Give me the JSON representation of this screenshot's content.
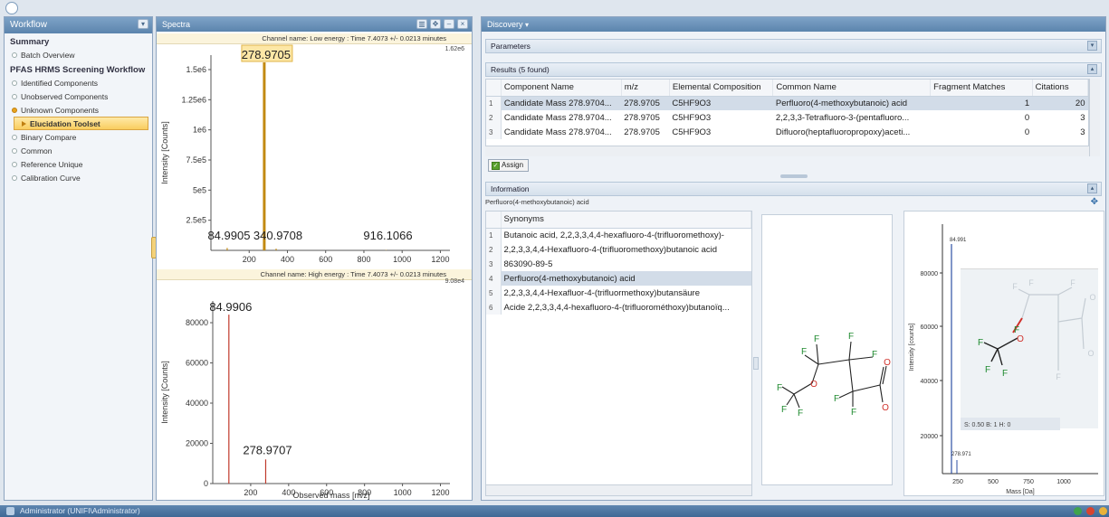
{
  "workflow": {
    "title": "Workflow",
    "sections": [
      {
        "title": "Summary",
        "items": [
          {
            "label": "Batch Overview",
            "state": "off"
          }
        ]
      },
      {
        "title": "PFAS HRMS Screening Workflow",
        "items": [
          {
            "label": "Identified Components",
            "state": "off"
          },
          {
            "label": "Unobserved Components",
            "state": "off"
          },
          {
            "label": "Unknown Components",
            "state": "on"
          },
          {
            "label": "Elucidation Toolset",
            "state": "active"
          },
          {
            "label": "Binary Compare",
            "state": "off"
          },
          {
            "label": "Common",
            "state": "off"
          },
          {
            "label": "Reference Unique",
            "state": "off"
          },
          {
            "label": "Calibration Curve",
            "state": "off"
          }
        ]
      }
    ]
  },
  "spectra": {
    "title": "Spectra",
    "low": {
      "channel": "Channel name: Low energy : Time 7.4073 +/- 0.0213 minutes",
      "max_label": "1.62e6",
      "ylabel": "Intensity [Counts]",
      "highlight": "278.9705"
    },
    "high": {
      "channel": "Channel name: High energy : Time 7.4073 +/- 0.0213 minutes",
      "max_label": "9.08e4",
      "ylabel": "Intensity [Counts]",
      "xlabel": "Observed mass [m/z]"
    }
  },
  "chart_data": [
    {
      "type": "bar",
      "title": "Channel name: Low energy : Time 7.4073 +/- 0.0213 minutes",
      "ylabel": "Intensity [Counts]",
      "xlim": [
        0,
        1250
      ],
      "ylim": [
        0,
        1620000
      ],
      "xticks": [
        200,
        400,
        600,
        800,
        1000,
        1200
      ],
      "yticks": [
        {
          "v": 250000,
          "t": "2.5e5"
        },
        {
          "v": 500000,
          "t": "5e5"
        },
        {
          "v": 750000,
          "t": "7.5e5"
        },
        {
          "v": 1000000,
          "t": "1e6"
        },
        {
          "v": 1250000,
          "t": "1.25e6"
        },
        {
          "v": 1500000,
          "t": "1.5e6"
        }
      ],
      "x": [
        84.9905,
        278.9705,
        340.9708,
        916.1066
      ],
      "values": [
        20000,
        1560000,
        14000,
        3000
      ],
      "labels": [
        "84.9905",
        "278.9705",
        "340.9708",
        "916.1066"
      ],
      "color": "#c28a12"
    },
    {
      "type": "bar",
      "title": "Channel name: High energy : Time 7.4073 +/- 0.0213 minutes",
      "ylabel": "Intensity [Counts]",
      "xlabel": "Observed mass [m/z]",
      "xlim": [
        0,
        1250
      ],
      "ylim": [
        0,
        90800
      ],
      "xticks": [
        200,
        400,
        600,
        800,
        1000,
        1200
      ],
      "yticks": [
        {
          "v": 0,
          "t": "0"
        },
        {
          "v": 20000,
          "t": "20000"
        },
        {
          "v": 40000,
          "t": "40000"
        },
        {
          "v": 60000,
          "t": "60000"
        },
        {
          "v": 80000,
          "t": "80000"
        }
      ],
      "x": [
        84.9906,
        278.9707
      ],
      "values": [
        84000,
        12000
      ],
      "labels": [
        "84.9906",
        "278.9707"
      ],
      "color": "#c0392b"
    }
  ],
  "discovery": {
    "title": "Discovery",
    "parameters_label": "Parameters",
    "results_label": "Results (5 found)",
    "columns": [
      "Component Name",
      "m/z",
      "Elemental Composition",
      "Common Name",
      "Fragment Matches",
      "Citations"
    ],
    "rows": [
      {
        "idx": "1",
        "name": "Candidate Mass 278.9704...",
        "mz": "278.9705",
        "comp": "C5HF9O3",
        "common": "Perfluoro(4-methoxybutanoic) acid",
        "frag": "1",
        "cit": "20",
        "selected": true
      },
      {
        "idx": "2",
        "name": "Candidate Mass 278.9704...",
        "mz": "278.9705",
        "comp": "C5HF9O3",
        "common": "2,2,3,3-Tetrafluoro-3-(pentafluoro...",
        "frag": "0",
        "cit": "3",
        "selected": false
      },
      {
        "idx": "3",
        "name": "Candidate Mass 278.9704...",
        "mz": "278.9705",
        "comp": "C5HF9O3",
        "common": "Difluoro(heptafluoropropoxy)aceti...",
        "frag": "0",
        "cit": "3",
        "selected": false
      }
    ],
    "assign_label": "Assign",
    "information_label": "Information",
    "info_compound": "Perfluoro(4-methoxybutanoic) acid",
    "synonyms_header": "Synonyms",
    "synonyms": [
      {
        "idx": "1",
        "text": "Butanoic acid, 2,2,3,3,4,4-hexafluoro-4-(trifluoromethoxy)-",
        "selected": false
      },
      {
        "idx": "2",
        "text": "2,2,3,3,4,4-Hexafluoro-4-(trifluoromethoxy)butanoic acid",
        "selected": false
      },
      {
        "idx": "3",
        "text": "863090-89-5",
        "selected": false
      },
      {
        "idx": "4",
        "text": "Perfluoro(4-methoxybutanoic) acid",
        "selected": true
      },
      {
        "idx": "5",
        "text": "2,2,3,3,4,4-Hexafluor-4-(trifluormethoxy)butansäure",
        "selected": false
      },
      {
        "idx": "6",
        "text": "Acide 2,2,3,3,4,4-hexafluoro-4-(trifluorométhoxy)butanoïq...",
        "selected": false
      }
    ],
    "frag_chart": {
      "ylabel": "Intensity [counts]",
      "xlabel": "Mass [Da]",
      "peak_label": "84.991",
      "small_label": "278.971",
      "annotation": "S: 0.50 B: 1 H: 0",
      "yticks": [
        "20000",
        "40000",
        "60000",
        "80000"
      ],
      "xticks": [
        "250",
        "500",
        "750",
        "1000"
      ]
    }
  },
  "status": {
    "user": "Administrator (UNIFI\\Administrator)"
  }
}
